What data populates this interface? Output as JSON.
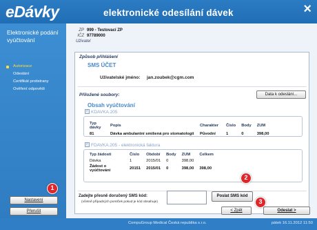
{
  "header": {
    "brand": "eDávky",
    "title": "elektronické odesílání dávek",
    "close": "×"
  },
  "sidebar": {
    "title": "Elektronické podání vyúčtování",
    "steps": [
      "Autorizace",
      "Odeslání",
      "Certifikát protistrany",
      "Ověření odpovědi"
    ],
    "active_step": 0,
    "settings_button": "Nastavení",
    "interrupt_button": "Přerušit"
  },
  "user": {
    "zp_label": "ZP",
    "zp_value": "999 - Testovací ZP",
    "icz_label": "IČZ",
    "icz_value": "97789000",
    "user_label": "Uživatel"
  },
  "login": {
    "section_title": "Způsob přihlášení",
    "method": "SMS ÚČET",
    "username_label": "Uživatelské jméno:",
    "username_value": "jan.zoubek@cgm.com"
  },
  "attachments": {
    "section_title": "Přiložené soubory:",
    "data_button": "Data k odeslání...",
    "content_title": "Obsah vyúčtování",
    "box1_label": "KDAVKA.205",
    "box1_table": {
      "headers": [
        "Typ dávky",
        "Popis",
        "Charakter",
        "Číslo",
        "Body",
        "ZUM"
      ],
      "rows": [
        [
          "81",
          "Dávka ambulantní smíšená pro stomatologii",
          "Původní",
          "1",
          "0",
          "398,00"
        ]
      ]
    },
    "box2_label": "FDAVKA.205 - elektronická faktura",
    "box2_table": {
      "headers": [
        "Typ žádosti",
        "Číslo",
        "Období",
        "Body",
        "ZUM",
        "Celkem"
      ],
      "rows": [
        [
          "Dávka",
          "1",
          "2015/01",
          "0",
          "398,00",
          ""
        ],
        [
          "Žádost o vyúčtování",
          "20151",
          "2015/01",
          "0",
          "398,00",
          "398,00"
        ]
      ]
    }
  },
  "sms": {
    "label": "Zadejte přesně doručený SMS kód:",
    "sub": "(včetně případných pomlček pokud je kód obsahuje)",
    "input_value": "",
    "send_button": "Poslat SMS kód"
  },
  "nav": {
    "back_button": "< Zpět",
    "send_button": "Odeslat >"
  },
  "footer": {
    "company": "CompuGroup Medical Česká republika s.r.o.",
    "datetime": "pátek 16.11.2012 11:50"
  },
  "markers": [
    "1",
    "2",
    "3"
  ]
}
